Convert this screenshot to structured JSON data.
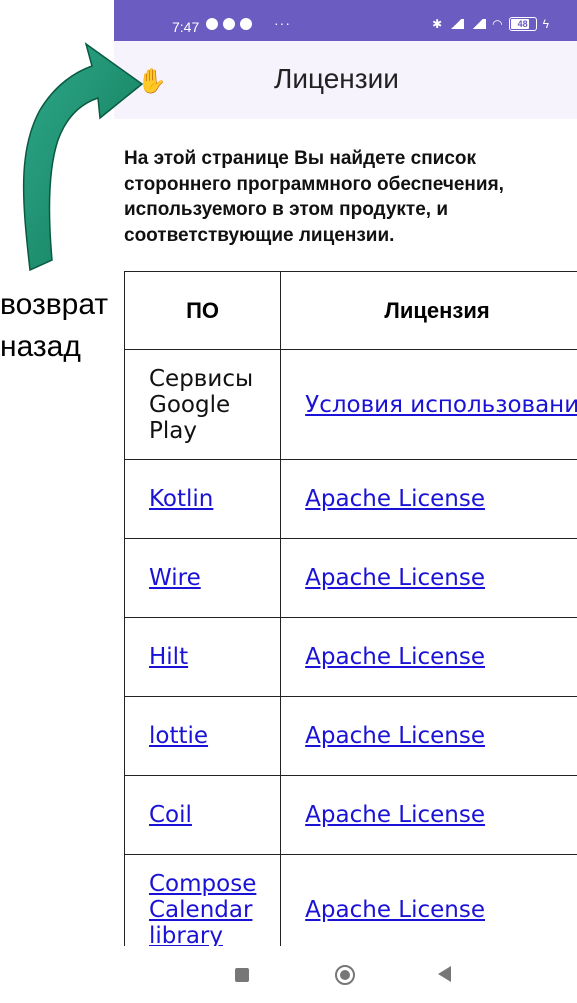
{
  "status_bar": {
    "time": "7:47",
    "more": "···",
    "battery": "48",
    "icons": [
      "telegram-icon",
      "telegram-icon",
      "notification-icon",
      "bluetooth-icon",
      "signal-icon",
      "volte-icon",
      "signal-icon",
      "wifi-icon",
      "battery-icon",
      "charging-icon"
    ]
  },
  "app_bar": {
    "title": "Лицензии",
    "back_icon": "hand-icon"
  },
  "intro_text": "На этой странице Вы найдете список стороннего программного обеспечения, используемого в этом продукте, и соответствующие лицензии.",
  "table": {
    "headers": {
      "software": "ПО",
      "license": "Лицензия"
    },
    "rows": [
      {
        "software": "Сервисы Google Play",
        "software_link": false,
        "license": "Условия использования"
      },
      {
        "software": "Kotlin",
        "software_link": true,
        "license": "Apache License"
      },
      {
        "software": "Wire",
        "software_link": true,
        "license": "Apache License"
      },
      {
        "software": "Hilt",
        "software_link": true,
        "license": "Apache License"
      },
      {
        "software": "lottie",
        "software_link": true,
        "license": "Apache License"
      },
      {
        "software": "Coil",
        "software_link": true,
        "license": "Apache License"
      },
      {
        "software": "Compose Calendar library",
        "software_link": true,
        "license": "Apache License"
      }
    ]
  },
  "annotation": {
    "line1": "возврат",
    "line2": "назад"
  },
  "colors": {
    "status_bar": "#6a5cc0",
    "app_bar": "#f6f3fc",
    "link": "#1a12d6",
    "arrow_fill": "#139b73",
    "arrow_stroke": "#0a5a40"
  }
}
